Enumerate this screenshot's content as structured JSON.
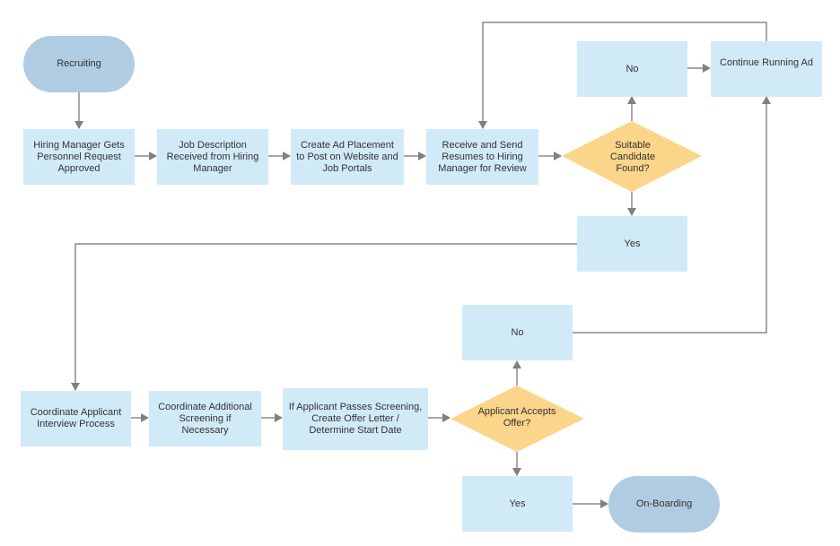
{
  "diagram": {
    "colors": {
      "process_fill": "#d1eaf7",
      "terminal_fill": "#b0cce3",
      "decision_fill": "#fbd589",
      "connector": "#808080",
      "text": "#333333"
    },
    "nodes": {
      "recruiting": "Recruiting",
      "hiring_manager": "Hiring Manager Gets Personnel Request Approved",
      "job_description": "Job Description Received from Hiring Manager",
      "create_ad": "Create Ad Placement to Post on Website and Job Portals",
      "receive_resumes": "Receive and Send Resumes to Hiring Manager for Review",
      "suitable_candidate": "Suitable Candidate Found?",
      "no_1": "No",
      "continue_ad": "Continue Running Ad",
      "yes_1": "Yes",
      "coordinate_interview": "Coordinate Applicant Interview Process",
      "coordinate_screening": "Coordinate Additional Screening if Necessary",
      "create_offer": "If Applicant Passes Screening, Create Offer Letter / Determine Start Date",
      "accepts_offer": "Applicant Accepts Offer?",
      "no_2": "No",
      "yes_2": "Yes",
      "onboarding": "On-Boarding"
    }
  }
}
